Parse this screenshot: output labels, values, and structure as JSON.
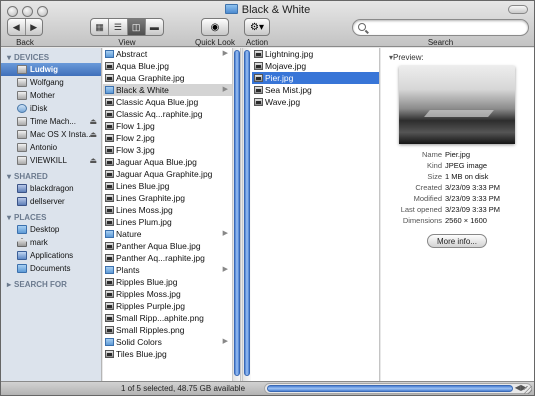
{
  "window": {
    "title": "Black & White"
  },
  "toolbar": {
    "back_label": "Back",
    "view_label": "View",
    "quicklook_label": "Quick Look",
    "action_label": "Action",
    "search_label": "Search",
    "search_placeholder": "",
    "back_icon": "left-arrow-icon",
    "forward_icon": "right-arrow-icon",
    "view_modes": [
      "icon-view-icon",
      "list-view-icon",
      "column-view-icon",
      "coverflow-view-icon"
    ],
    "view_selected": 2
  },
  "sidebar": {
    "devices_label": "DEVICES",
    "devices": [
      {
        "label": "Ludwig",
        "icon": "hard-disk-icon",
        "selected": true,
        "eject": false
      },
      {
        "label": "Wolfgang",
        "icon": "hard-disk-icon",
        "eject": false
      },
      {
        "label": "Mother",
        "icon": "hard-disk-icon",
        "eject": false
      },
      {
        "label": "iDisk",
        "icon": "idisk-icon",
        "eject": false
      },
      {
        "label": "Time Mach...",
        "icon": "hard-disk-icon",
        "eject": true
      },
      {
        "label": "Mac OS X Insta...",
        "icon": "hard-disk-icon",
        "eject": true
      },
      {
        "label": "Antonio",
        "icon": "hard-disk-icon",
        "eject": false
      },
      {
        "label": "VIEWKILL",
        "icon": "hard-disk-icon",
        "eject": true
      }
    ],
    "shared_label": "SHARED",
    "shared": [
      {
        "label": "blackdragon",
        "icon": "network-computer-icon"
      },
      {
        "label": "dellserver",
        "icon": "network-computer-icon"
      }
    ],
    "places_label": "PLACES",
    "places": [
      {
        "label": "Desktop",
        "icon": "desktop-folder-icon"
      },
      {
        "label": "mark",
        "icon": "home-icon"
      },
      {
        "label": "Applications",
        "icon": "applications-icon"
      },
      {
        "label": "Documents",
        "icon": "documents-folder-icon"
      }
    ],
    "searchfor_label": "SEARCH FOR"
  },
  "column1": {
    "items": [
      {
        "label": "Abstract",
        "kind": "folder"
      },
      {
        "label": "Aqua Blue.jpg",
        "kind": "image"
      },
      {
        "label": "Aqua Graphite.jpg",
        "kind": "image"
      },
      {
        "label": "Black & White",
        "kind": "folder",
        "selected": true
      },
      {
        "label": "Classic Aqua Blue.jpg",
        "kind": "image"
      },
      {
        "label": "Classic Aq...raphite.jpg",
        "kind": "image"
      },
      {
        "label": "Flow 1.jpg",
        "kind": "image"
      },
      {
        "label": "Flow 2.jpg",
        "kind": "image"
      },
      {
        "label": "Flow 3.jpg",
        "kind": "image"
      },
      {
        "label": "Jaguar Aqua Blue.jpg",
        "kind": "image"
      },
      {
        "label": "Jaguar Aqua Graphite.jpg",
        "kind": "image"
      },
      {
        "label": "Lines Blue.jpg",
        "kind": "image"
      },
      {
        "label": "Lines Graphite.jpg",
        "kind": "image"
      },
      {
        "label": "Lines Moss.jpg",
        "kind": "image"
      },
      {
        "label": "Lines Plum.jpg",
        "kind": "image"
      },
      {
        "label": "Nature",
        "kind": "folder"
      },
      {
        "label": "Panther Aqua Blue.jpg",
        "kind": "image"
      },
      {
        "label": "Panther Aq...raphite.jpg",
        "kind": "image"
      },
      {
        "label": "Plants",
        "kind": "folder"
      },
      {
        "label": "Ripples Blue.jpg",
        "kind": "image"
      },
      {
        "label": "Ripples Moss.jpg",
        "kind": "image"
      },
      {
        "label": "Ripples Purple.jpg",
        "kind": "image"
      },
      {
        "label": "Small Ripp...aphite.png",
        "kind": "image"
      },
      {
        "label": "Small Ripples.png",
        "kind": "image"
      },
      {
        "label": "Solid Colors",
        "kind": "folder"
      },
      {
        "label": "Tiles Blue.jpg",
        "kind": "image"
      }
    ]
  },
  "column2": {
    "items": [
      {
        "label": "Lightning.jpg",
        "kind": "image"
      },
      {
        "label": "Mojave.jpg",
        "kind": "image"
      },
      {
        "label": "Pier.jpg",
        "kind": "image",
        "selected": true
      },
      {
        "label": "Sea Mist.jpg",
        "kind": "image"
      },
      {
        "label": "Wave.jpg",
        "kind": "image"
      }
    ]
  },
  "preview": {
    "label": "Preview:",
    "meta": [
      {
        "k": "Name",
        "v": "Pier.jpg"
      },
      {
        "k": "Kind",
        "v": "JPEG image"
      },
      {
        "k": "Size",
        "v": "1 MB on disk"
      },
      {
        "k": "Created",
        "v": "3/23/09 3:33 PM"
      },
      {
        "k": "Modified",
        "v": "3/23/09 3:33 PM"
      },
      {
        "k": "Last opened",
        "v": "3/23/09 3:33 PM"
      },
      {
        "k": "Dimensions",
        "v": "2560 × 1600"
      }
    ],
    "more_info_label": "More info..."
  },
  "status": {
    "text": "1 of 5 selected, 48.75 GB available"
  }
}
